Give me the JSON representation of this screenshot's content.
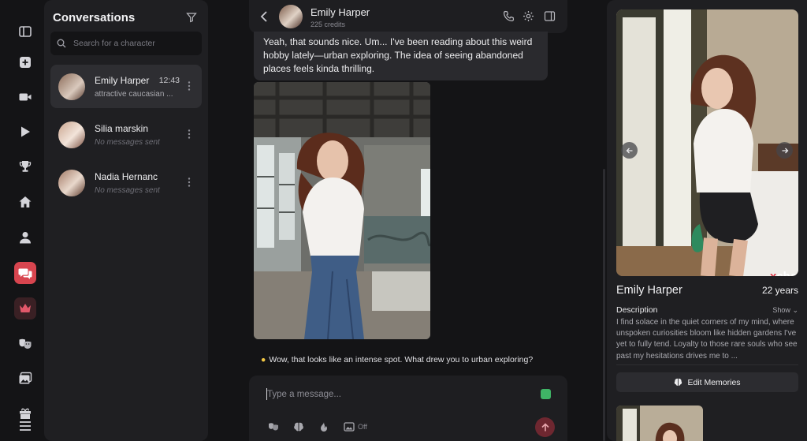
{
  "colors": {
    "accent": "#d8454f",
    "background": "#141416",
    "panel": "#1f1f22"
  },
  "rail": {
    "items": [
      {
        "icon": "sidebar-toggle-icon"
      },
      {
        "icon": "plus-square-icon"
      },
      {
        "icon": "video-icon"
      },
      {
        "icon": "play-icon"
      },
      {
        "icon": "trophy-icon"
      },
      {
        "icon": "home-icon"
      },
      {
        "icon": "user-icon"
      },
      {
        "icon": "chat-icon",
        "active": true
      },
      {
        "icon": "crown-icon"
      },
      {
        "icon": "masks-icon"
      },
      {
        "icon": "gallery-icon"
      },
      {
        "icon": "gift-icon"
      },
      {
        "icon": "menu-icon"
      }
    ]
  },
  "conversations": {
    "title": "Conversations",
    "search_placeholder": "Search for a character",
    "items": [
      {
        "name": "Emily Harper",
        "time": "12:43",
        "preview": "attractive caucasian ...",
        "active": true
      },
      {
        "name": "Silia marskin",
        "time": "",
        "preview": "No messages sent"
      },
      {
        "name": "Nadia Hernanc",
        "time": "",
        "preview": "No messages sent"
      }
    ]
  },
  "chat": {
    "name": "Emily Harper",
    "credits": "225 credits",
    "message": "Yeah, that sounds nice. Um... I've been reading about this weird hobby lately—urban exploring. The idea of seeing abandoned places feels kinda thrilling.",
    "suggestion": "Wow, that looks like an intense spot. What drew you to urban exploring?",
    "input_placeholder": "Type a message...",
    "image_toggle_label": "Off"
  },
  "profile": {
    "name": "Emily Harper",
    "age": "22 years",
    "description_label": "Description",
    "show_label": "Show",
    "description": "I find solace in the quiet corners of my mind, where unspoken curiosities bloom like hidden gardens I've yet to fully tend. Loyalty to those rare souls who see past my hesitations drives me to ...",
    "edit_memories_label": "Edit Memories",
    "watermark_prefix": "x",
    "watermark_text": "char"
  }
}
